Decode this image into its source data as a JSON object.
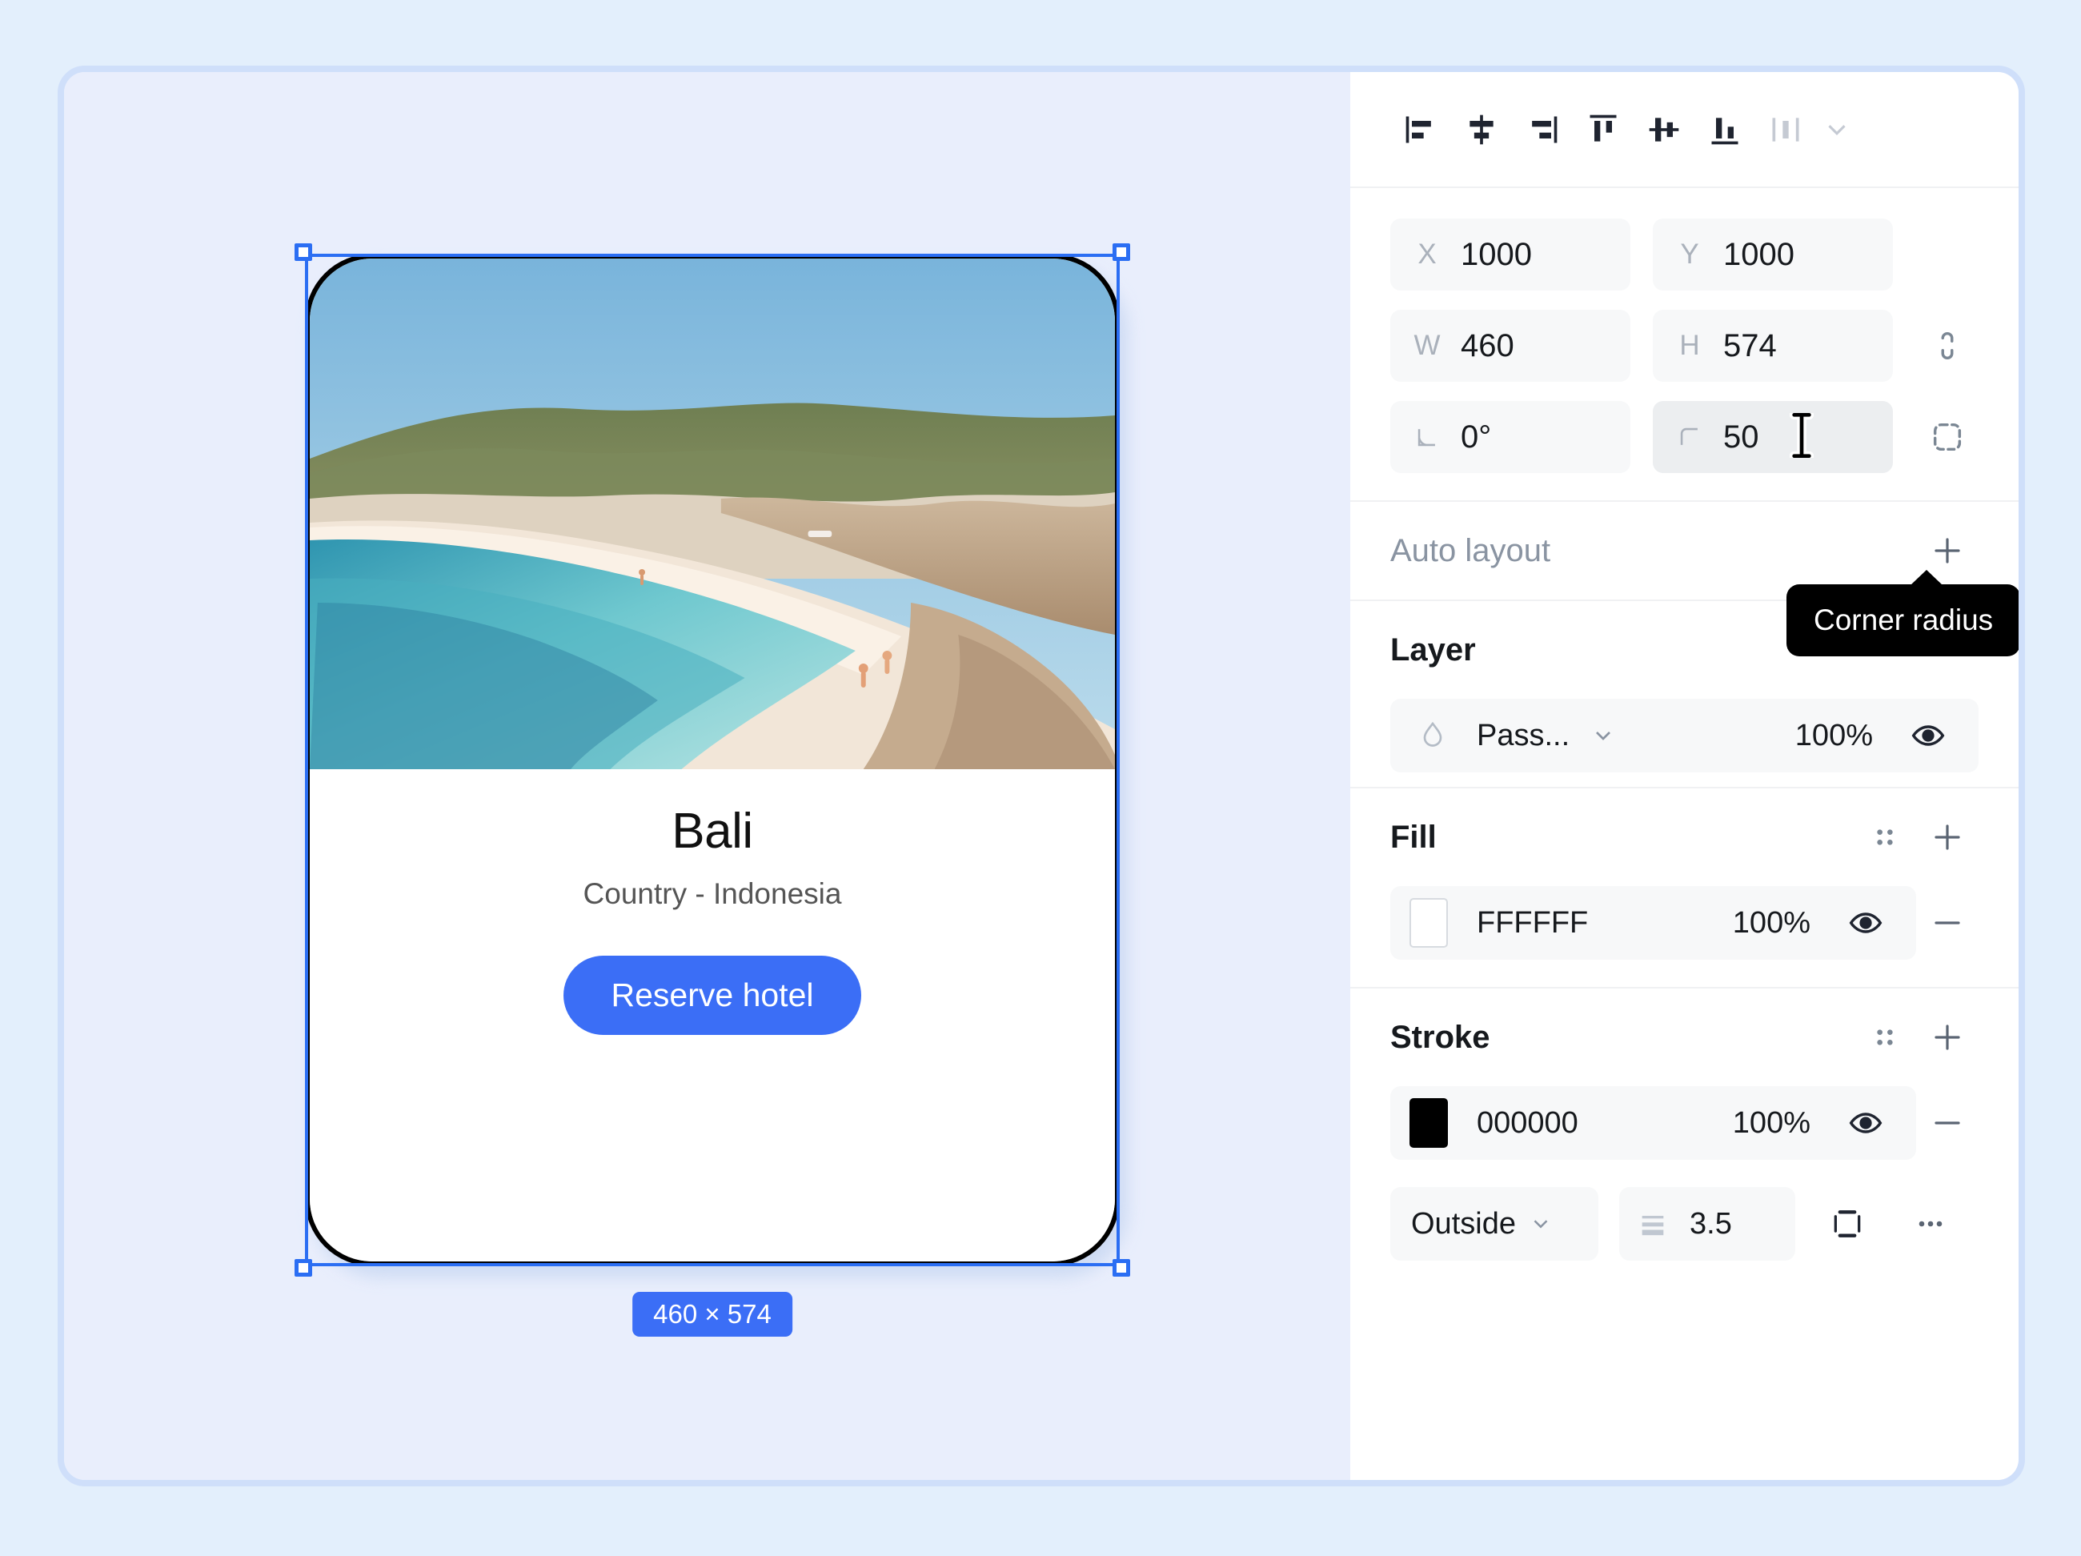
{
  "canvas": {
    "card": {
      "title": "Bali",
      "subtitle": "Country - Indonesia",
      "button_label": "Reserve hotel",
      "button_color": "#3b6ef6",
      "fill": "#FFFFFF",
      "stroke": "#000000"
    },
    "size_badge": "460 × 574",
    "selection_color": "#2b6ef3"
  },
  "panel": {
    "align_tools": [
      {
        "name": "align-left",
        "label": "Align left"
      },
      {
        "name": "align-horizontal-center",
        "label": "Align horizontal centers"
      },
      {
        "name": "align-right",
        "label": "Align right"
      },
      {
        "name": "align-top",
        "label": "Align top"
      },
      {
        "name": "align-vertical-center",
        "label": "Align vertical centers"
      },
      {
        "name": "align-bottom",
        "label": "Align bottom"
      },
      {
        "name": "distribute",
        "label": "Distribute"
      }
    ],
    "dimensions": {
      "x": {
        "icon": "X",
        "value": "1000"
      },
      "y": {
        "icon": "Y",
        "value": "1000"
      },
      "w": {
        "icon": "W",
        "value": "460"
      },
      "h": {
        "icon": "H",
        "value": "574"
      },
      "rotation": {
        "value": "0°"
      },
      "corner_radius": {
        "value": "50"
      }
    },
    "tooltip": "Corner radius",
    "auto_layout": {
      "label": "Auto layout",
      "add": "+"
    },
    "layer": {
      "title": "Layer",
      "blend_mode": "Pass...",
      "opacity": "100%"
    },
    "fill": {
      "title": "Fill",
      "hex": "FFFFFF",
      "opacity": "100%"
    },
    "stroke": {
      "title": "Stroke",
      "hex": "000000",
      "opacity": "100%",
      "align": "Outside",
      "weight": "3.5"
    }
  }
}
